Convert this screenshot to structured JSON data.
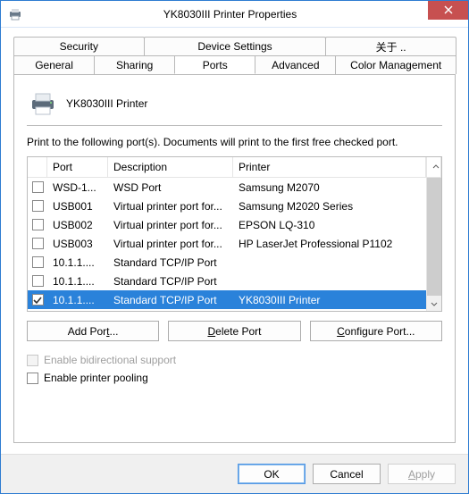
{
  "window": {
    "title": "YK8030III Printer Properties"
  },
  "tabs": {
    "row1": [
      "Security",
      "Device Settings",
      "关于 .."
    ],
    "row2": [
      "General",
      "Sharing",
      "Ports",
      "Advanced",
      "Color Management"
    ],
    "active": "Ports"
  },
  "ports_page": {
    "printer_name": "YK8030III Printer",
    "intro": "Print to the following port(s). Documents will print to the first free checked port.",
    "columns": {
      "port": "Port",
      "description": "Description",
      "printer": "Printer"
    },
    "rows": [
      {
        "checked": false,
        "port": "WSD-1...",
        "description": "WSD Port",
        "printer": "Samsung M2070"
      },
      {
        "checked": false,
        "port": "USB001",
        "description": "Virtual printer port for...",
        "printer": "Samsung M2020 Series"
      },
      {
        "checked": false,
        "port": "USB002",
        "description": "Virtual printer port for...",
        "printer": "EPSON LQ-310"
      },
      {
        "checked": false,
        "port": "USB003",
        "description": "Virtual printer port for...",
        "printer": "HP LaserJet Professional P1102"
      },
      {
        "checked": false,
        "port": "10.1.1....",
        "description": "Standard TCP/IP Port",
        "printer": ""
      },
      {
        "checked": false,
        "port": "10.1.1....",
        "description": "Standard TCP/IP Port",
        "printer": ""
      },
      {
        "checked": true,
        "port": "10.1.1....",
        "description": "Standard TCP/IP Port",
        "printer": "YK8030III Printer",
        "selected": true
      }
    ],
    "buttons": {
      "add": "Add Port...",
      "delete": "Delete Port",
      "configure": "Configure Port..."
    },
    "enable_bidi": {
      "label": "Enable bidirectional support",
      "checked": false,
      "disabled": true
    },
    "enable_pool": {
      "label": "Enable printer pooling",
      "checked": false,
      "disabled": false
    }
  },
  "footer": {
    "ok": "OK",
    "cancel": "Cancel",
    "apply": "Apply"
  }
}
